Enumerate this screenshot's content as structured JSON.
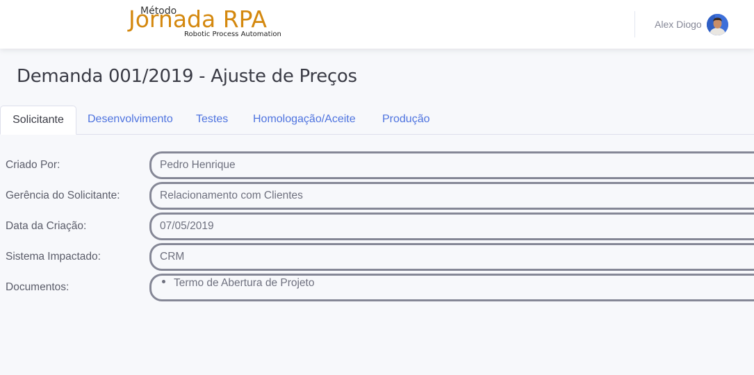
{
  "header": {
    "logo": {
      "small_text": "Método",
      "main_text": "Jornada RPA",
      "sub_text": "Robotic Process Automation"
    },
    "user_name": "Alex Diogo"
  },
  "page": {
    "title": "Demanda 001/2019 - Ajuste de Preços"
  },
  "tabs": [
    {
      "label": "Solicitante",
      "active": true
    },
    {
      "label": "Desenvolvimento",
      "active": false
    },
    {
      "label": "Testes",
      "active": false
    },
    {
      "label": "Homologação/Aceite",
      "active": false
    },
    {
      "label": "Produção",
      "active": false
    }
  ],
  "form": {
    "fields": [
      {
        "label": "Criado Por:",
        "value": "Pedro Henrique"
      },
      {
        "label": "Gerência do Solicitante:",
        "value": "Relacionamento com Clientes"
      },
      {
        "label": "Data da Criação:",
        "value": "07/05/2019"
      },
      {
        "label": "Sistema Impactado:",
        "value": "CRM"
      }
    ],
    "documents": {
      "label": "Documentos:",
      "items": [
        "Termo de Abertura de Projeto"
      ]
    }
  },
  "colors": {
    "accent": "#4e73df",
    "logo_orange": "#d4880e",
    "field_border": "#858796",
    "background": "#f7f8fb"
  }
}
